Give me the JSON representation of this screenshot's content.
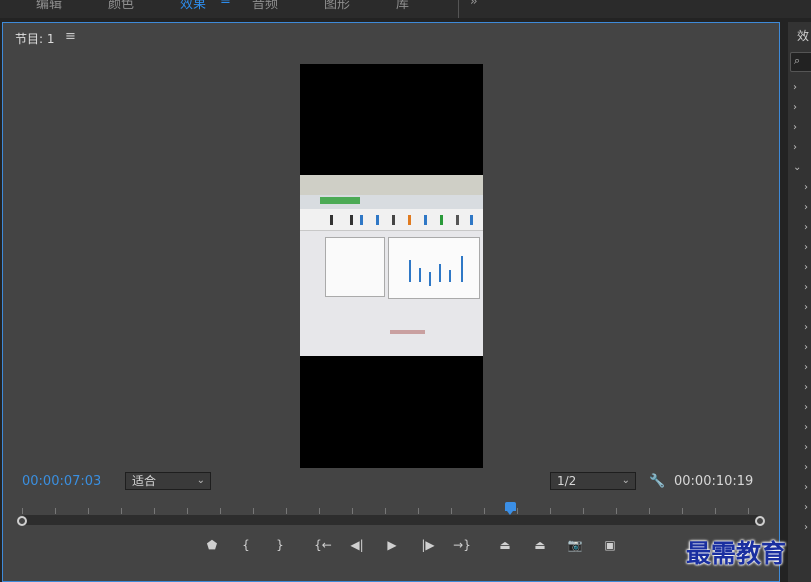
{
  "workspace": {
    "tabs": [
      "编辑",
      "颜色",
      "效果",
      "音频",
      "图形",
      "库"
    ],
    "active_tab": "效果",
    "menu_icon": "hamburger-icon",
    "overflow_icon": "double-chevron-right-icon"
  },
  "monitor": {
    "title": "节目: 1",
    "menu_icon": "hamburger-icon",
    "timecode_current": "00:00:07:03",
    "timecode_duration": "00:00:10:19",
    "zoom_select": {
      "value": "适合"
    },
    "resolution_select": {
      "value": "1/2"
    },
    "playhead_fraction": 0.66,
    "controls": [
      {
        "name": "add-marker-button",
        "icon": "marker-icon",
        "glyph": "⬟"
      },
      {
        "name": "mark-in-button",
        "icon": "mark-in-icon",
        "glyph": "{"
      },
      {
        "name": "mark-out-button",
        "icon": "mark-out-icon",
        "glyph": "}"
      },
      {
        "name": "go-to-in-button",
        "icon": "go-to-in-icon",
        "glyph": "{←"
      },
      {
        "name": "step-back-button",
        "icon": "step-back-icon",
        "glyph": "◀|"
      },
      {
        "name": "play-button",
        "icon": "play-icon",
        "glyph": "▶"
      },
      {
        "name": "step-forward-button",
        "icon": "step-forward-icon",
        "glyph": "|▶"
      },
      {
        "name": "go-to-out-button",
        "icon": "go-to-out-icon",
        "glyph": "→}"
      },
      {
        "name": "lift-button",
        "icon": "lift-icon",
        "glyph": "⏏"
      },
      {
        "name": "extract-button",
        "icon": "extract-icon",
        "glyph": "⏏"
      },
      {
        "name": "export-frame-button",
        "icon": "camera-icon",
        "glyph": "📷"
      },
      {
        "name": "comparison-view-button",
        "icon": "compare-icon",
        "glyph": "▣"
      }
    ]
  },
  "effects_panel": {
    "title": "效",
    "search_icon": "search-icon"
  },
  "watermark": "最需教育",
  "colors": {
    "accent": "#2d8ceb",
    "panel": "#444444",
    "background": "#232323"
  }
}
